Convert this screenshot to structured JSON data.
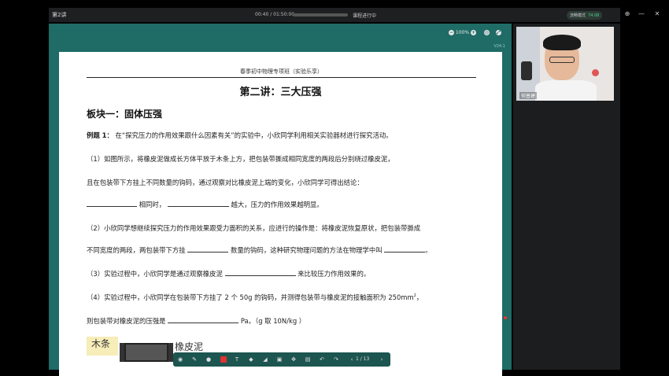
{
  "appbar": {
    "title": "第2讲",
    "time": "00:40 / 01:50:00",
    "status": "课程进行中",
    "speed_label": "流畅模式",
    "speed_value": "74.08"
  },
  "stage": {
    "zoom": "100%",
    "version": "V24.1"
  },
  "paper": {
    "header": "春季初中物理专项班（实验乐享）",
    "lecture_title": "第二讲：三大压强",
    "section_title": "板块一：固体压强",
    "example_label": "例题 1：",
    "example_text": "在“探究压力的作用效果跟什么因素有关”的实验中，小欣同学利用相关实验器材进行探究活动。",
    "q1_line1": "（1）如图所示，将橡皮泥做成长方体平放于木条上方，把包装带撕成相同宽度的两段后分别绕过橡皮泥，",
    "q1_line2": "且在包装带下方挂上不同数量的钩码，通过观察对比橡皮泥上端的变化，小欣同学可得出结论：",
    "q1_line3_a": "相同时，",
    "q1_line3_b": "越大，压力的作用效果越明显。",
    "q2_line1": "（2）小欣同学想继续探究压力的作用效果跟受力面积的关系，应进行的操作是：将橡皮泥恢复原状，把包装带撕成",
    "q2_line2_a": "不同宽度的两段，两包装带下方挂",
    "q2_line2_b": "数量的钩码，这种研究物理问题的方法在物理学中叫",
    "q2_line2_c": "。",
    "q3_a": "（3）实验过程中，小欣同学是通过观察橡皮泥",
    "q3_b": "来比较压力作用效果的。",
    "q4_line1_a": "（4）实验过程中，小欣同学在包装带下方挂了 2 个 50g 的钩码，并测得包装带与橡皮泥的接触面积为 250mm",
    "q4_sup": "2",
    "q4_line1_b": "，",
    "q4_line2_a": "则包装带对橡皮泥的压强是",
    "q4_line2_b": "Pa。（g 取 10N/kg ）",
    "figure_wood": "木条",
    "figure_clay": "橡皮泥"
  },
  "toolbar": {
    "page_current": "1",
    "page_total": "/ 13"
  },
  "camera": {
    "name": "何普建"
  }
}
